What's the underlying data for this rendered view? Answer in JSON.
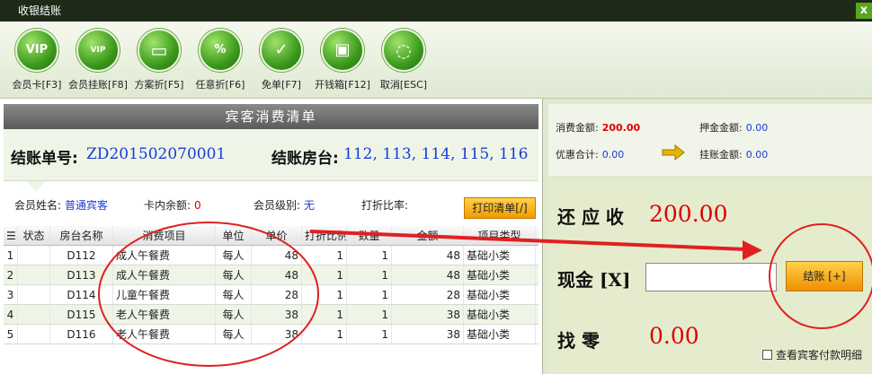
{
  "window": {
    "title": "收银结账",
    "close_label": "x"
  },
  "toolbar": {
    "items": [
      {
        "label": "会员卡[F3]",
        "icon": "vip-icon",
        "glyph": "VIP"
      },
      {
        "label": "会员挂账[F8]",
        "icon": "member-account-icon",
        "glyph": "VIP"
      },
      {
        "label": "方案折[F5]",
        "icon": "scheme-discount-icon",
        "glyph": "▭"
      },
      {
        "label": "任意折[F6]",
        "icon": "custom-discount-icon",
        "glyph": "%"
      },
      {
        "label": "免单[F7]",
        "icon": "free-order-icon",
        "glyph": "✓"
      },
      {
        "label": "开钱箱[F12]",
        "icon": "cash-drawer-icon",
        "glyph": "▣"
      },
      {
        "label": "取消[ESC]",
        "icon": "cancel-icon",
        "glyph": "◌"
      }
    ]
  },
  "bill": {
    "header": "宾客消费清单",
    "no_label": "结账单号:",
    "no_value": "ZD201502070001",
    "room_label": "结账房台:",
    "room_value": "112, 113, 114, 115, 116",
    "member_name_label": "会员姓名:",
    "member_name_value": "普通宾客",
    "card_balance_label": "卡内余额:",
    "card_balance_value": "0",
    "member_level_label": "会员级别:",
    "member_level_value": "无",
    "discount_rate_label": "打折比率:",
    "discount_rate_value": "",
    "print_button": "打印清单[/]"
  },
  "table": {
    "headers": [
      "",
      "状态",
      "房台名称",
      "消费项目",
      "单位",
      "单价",
      "打折比例",
      "数量",
      "金额",
      "项目类型"
    ],
    "rows": [
      [
        "1",
        "",
        "D112",
        "成人午餐费",
        "每人",
        "48",
        "1",
        "1",
        "48",
        "基础小类"
      ],
      [
        "2",
        "",
        "D113",
        "成人午餐费",
        "每人",
        "48",
        "1",
        "1",
        "48",
        "基础小类"
      ],
      [
        "3",
        "",
        "D114",
        "儿童午餐费",
        "每人",
        "28",
        "1",
        "1",
        "28",
        "基础小类"
      ],
      [
        "4",
        "",
        "D115",
        "老人午餐费",
        "每人",
        "38",
        "1",
        "1",
        "38",
        "基础小类"
      ],
      [
        "5",
        "",
        "D116",
        "老人午餐费",
        "每人",
        "38",
        "1",
        "1",
        "38",
        "基础小类"
      ]
    ]
  },
  "summary": {
    "consume_label": "消费金额:",
    "consume_value": "200.00",
    "deposit_label": "押金金额:",
    "deposit_value": "0.00",
    "discount_label": "优惠合计:",
    "discount_value": "0.00",
    "charge_label": "挂账金额:",
    "charge_value": "0.00"
  },
  "payment": {
    "due_label": "还 应 收",
    "due_value": "200.00",
    "cash_label": "现金 [X]",
    "cash_value": "",
    "checkout_button": "结账 [+]",
    "change_label": "找    零",
    "change_value": "0.00",
    "detail_checkbox": "查看宾客付款明细"
  },
  "colors": {
    "accent_red": "#d00000",
    "link_blue": "#1a3bd6",
    "button_orange": "#f0a000",
    "annotation_red": "#e02020"
  }
}
